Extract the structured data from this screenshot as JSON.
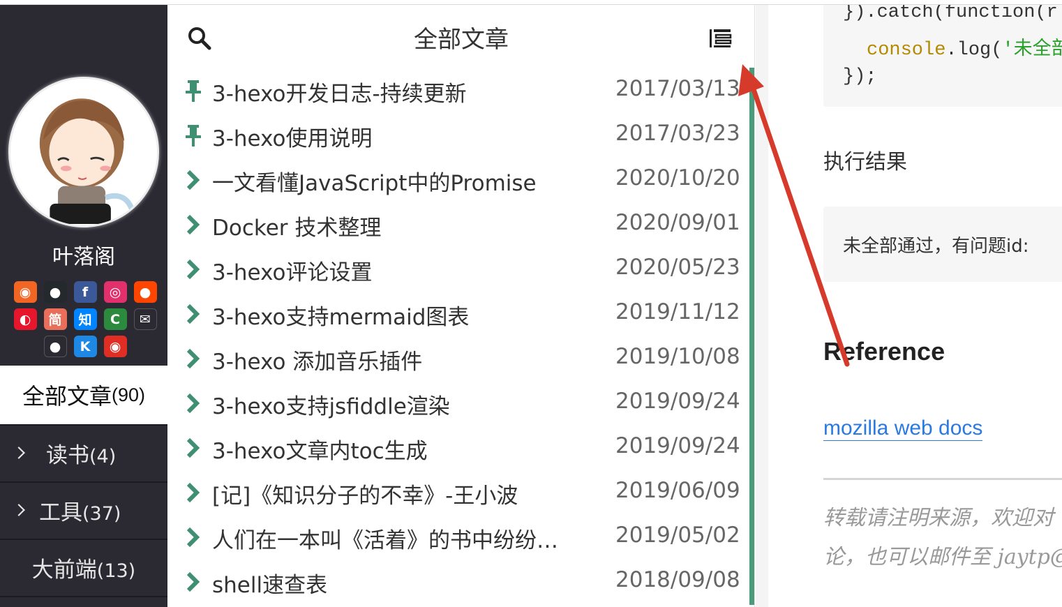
{
  "sidebar": {
    "author": "叶落阁",
    "socials": [
      [
        {
          "name": "rss-icon",
          "glyph": "◉",
          "color": "#f26522"
        },
        {
          "name": "github-icon",
          "glyph": "●",
          "color": "#24292e"
        },
        {
          "name": "facebook-icon",
          "glyph": "f",
          "color": "#3b5998"
        },
        {
          "name": "instagram-icon",
          "glyph": "◎",
          "color": "#e1306c"
        },
        {
          "name": "reddit-icon",
          "glyph": "●",
          "color": "#ff4500"
        }
      ],
      [
        {
          "name": "weibo-icon",
          "glyph": "◐",
          "color": "#e6162d"
        },
        {
          "name": "jianshu-icon",
          "glyph": "简",
          "color": "#ea6f5a"
        },
        {
          "name": "zhihu-icon",
          "glyph": "知",
          "color": "#0084ff"
        },
        {
          "name": "csdn-icon",
          "glyph": "C",
          "color": "#2b8a3e"
        },
        {
          "name": "email-icon",
          "glyph": "✉",
          "color": "#2b2a33"
        }
      ],
      [
        {
          "name": "qq-icon",
          "glyph": "●",
          "color": "#2b2a33"
        },
        {
          "name": "kugou-icon",
          "glyph": "K",
          "color": "#1e88e5"
        },
        {
          "name": "netease-music-icon",
          "glyph": "◉",
          "color": "#e02e24"
        }
      ]
    ],
    "nav": {
      "all": {
        "label": "全部文章",
        "count": "(90)"
      },
      "items": [
        {
          "label": "读书",
          "count": "(4)"
        },
        {
          "label": "工具",
          "count": "(37)"
        },
        {
          "label": "大前端",
          "count": "(13)"
        }
      ]
    }
  },
  "panel": {
    "title": "全部文章",
    "articles": [
      {
        "title": "3-hexo开发日志-持续更新",
        "date": "2017/03/13",
        "pinned": true
      },
      {
        "title": "3-hexo使用说明",
        "date": "2017/03/23",
        "pinned": true
      },
      {
        "title": "一文看懂JavaScript中的Promise",
        "date": "2020/10/20",
        "pinned": false
      },
      {
        "title": "Docker 技术整理",
        "date": "2020/09/01",
        "pinned": false
      },
      {
        "title": "3-hexo评论设置",
        "date": "2020/05/23",
        "pinned": false
      },
      {
        "title": "3-hexo支持mermaid图表",
        "date": "2019/11/12",
        "pinned": false
      },
      {
        "title": "3-hexo 添加音乐插件",
        "date": "2019/10/08",
        "pinned": false
      },
      {
        "title": "3-hexo支持jsfiddle渲染",
        "date": "2019/09/24",
        "pinned": false
      },
      {
        "title": "3-hexo文章内toc生成",
        "date": "2019/09/24",
        "pinned": false
      },
      {
        "title": "[记]《知识分子的不幸》-王小波",
        "date": "2019/06/09",
        "pinned": false
      },
      {
        "title": "人们在一本叫《活着》的书中纷纷…",
        "date": "2019/05/02",
        "pinned": false
      },
      {
        "title": "shell速查表",
        "date": "2018/09/08",
        "pinned": false
      }
    ]
  },
  "content": {
    "code": {
      "line1": "}).catch(function(r",
      "line2_fn": "console",
      "line2_mid": ".log(",
      "line2_str": "'未全部",
      "line3": "});"
    },
    "result_heading": "执行结果",
    "result_text": "未全部通过，有问题id:",
    "reference_heading": "Reference",
    "reference_link": "mozilla web docs",
    "note_line1": "转载请注明来源，欢迎对",
    "note_line2": "论，也可以邮件至 jaytp@"
  },
  "colors": {
    "sidebar_bg": "#2b2a33",
    "accent_green": "#4a9a7c",
    "annotation_red": "#d63a2a",
    "link_blue": "#2a7ae2"
  }
}
